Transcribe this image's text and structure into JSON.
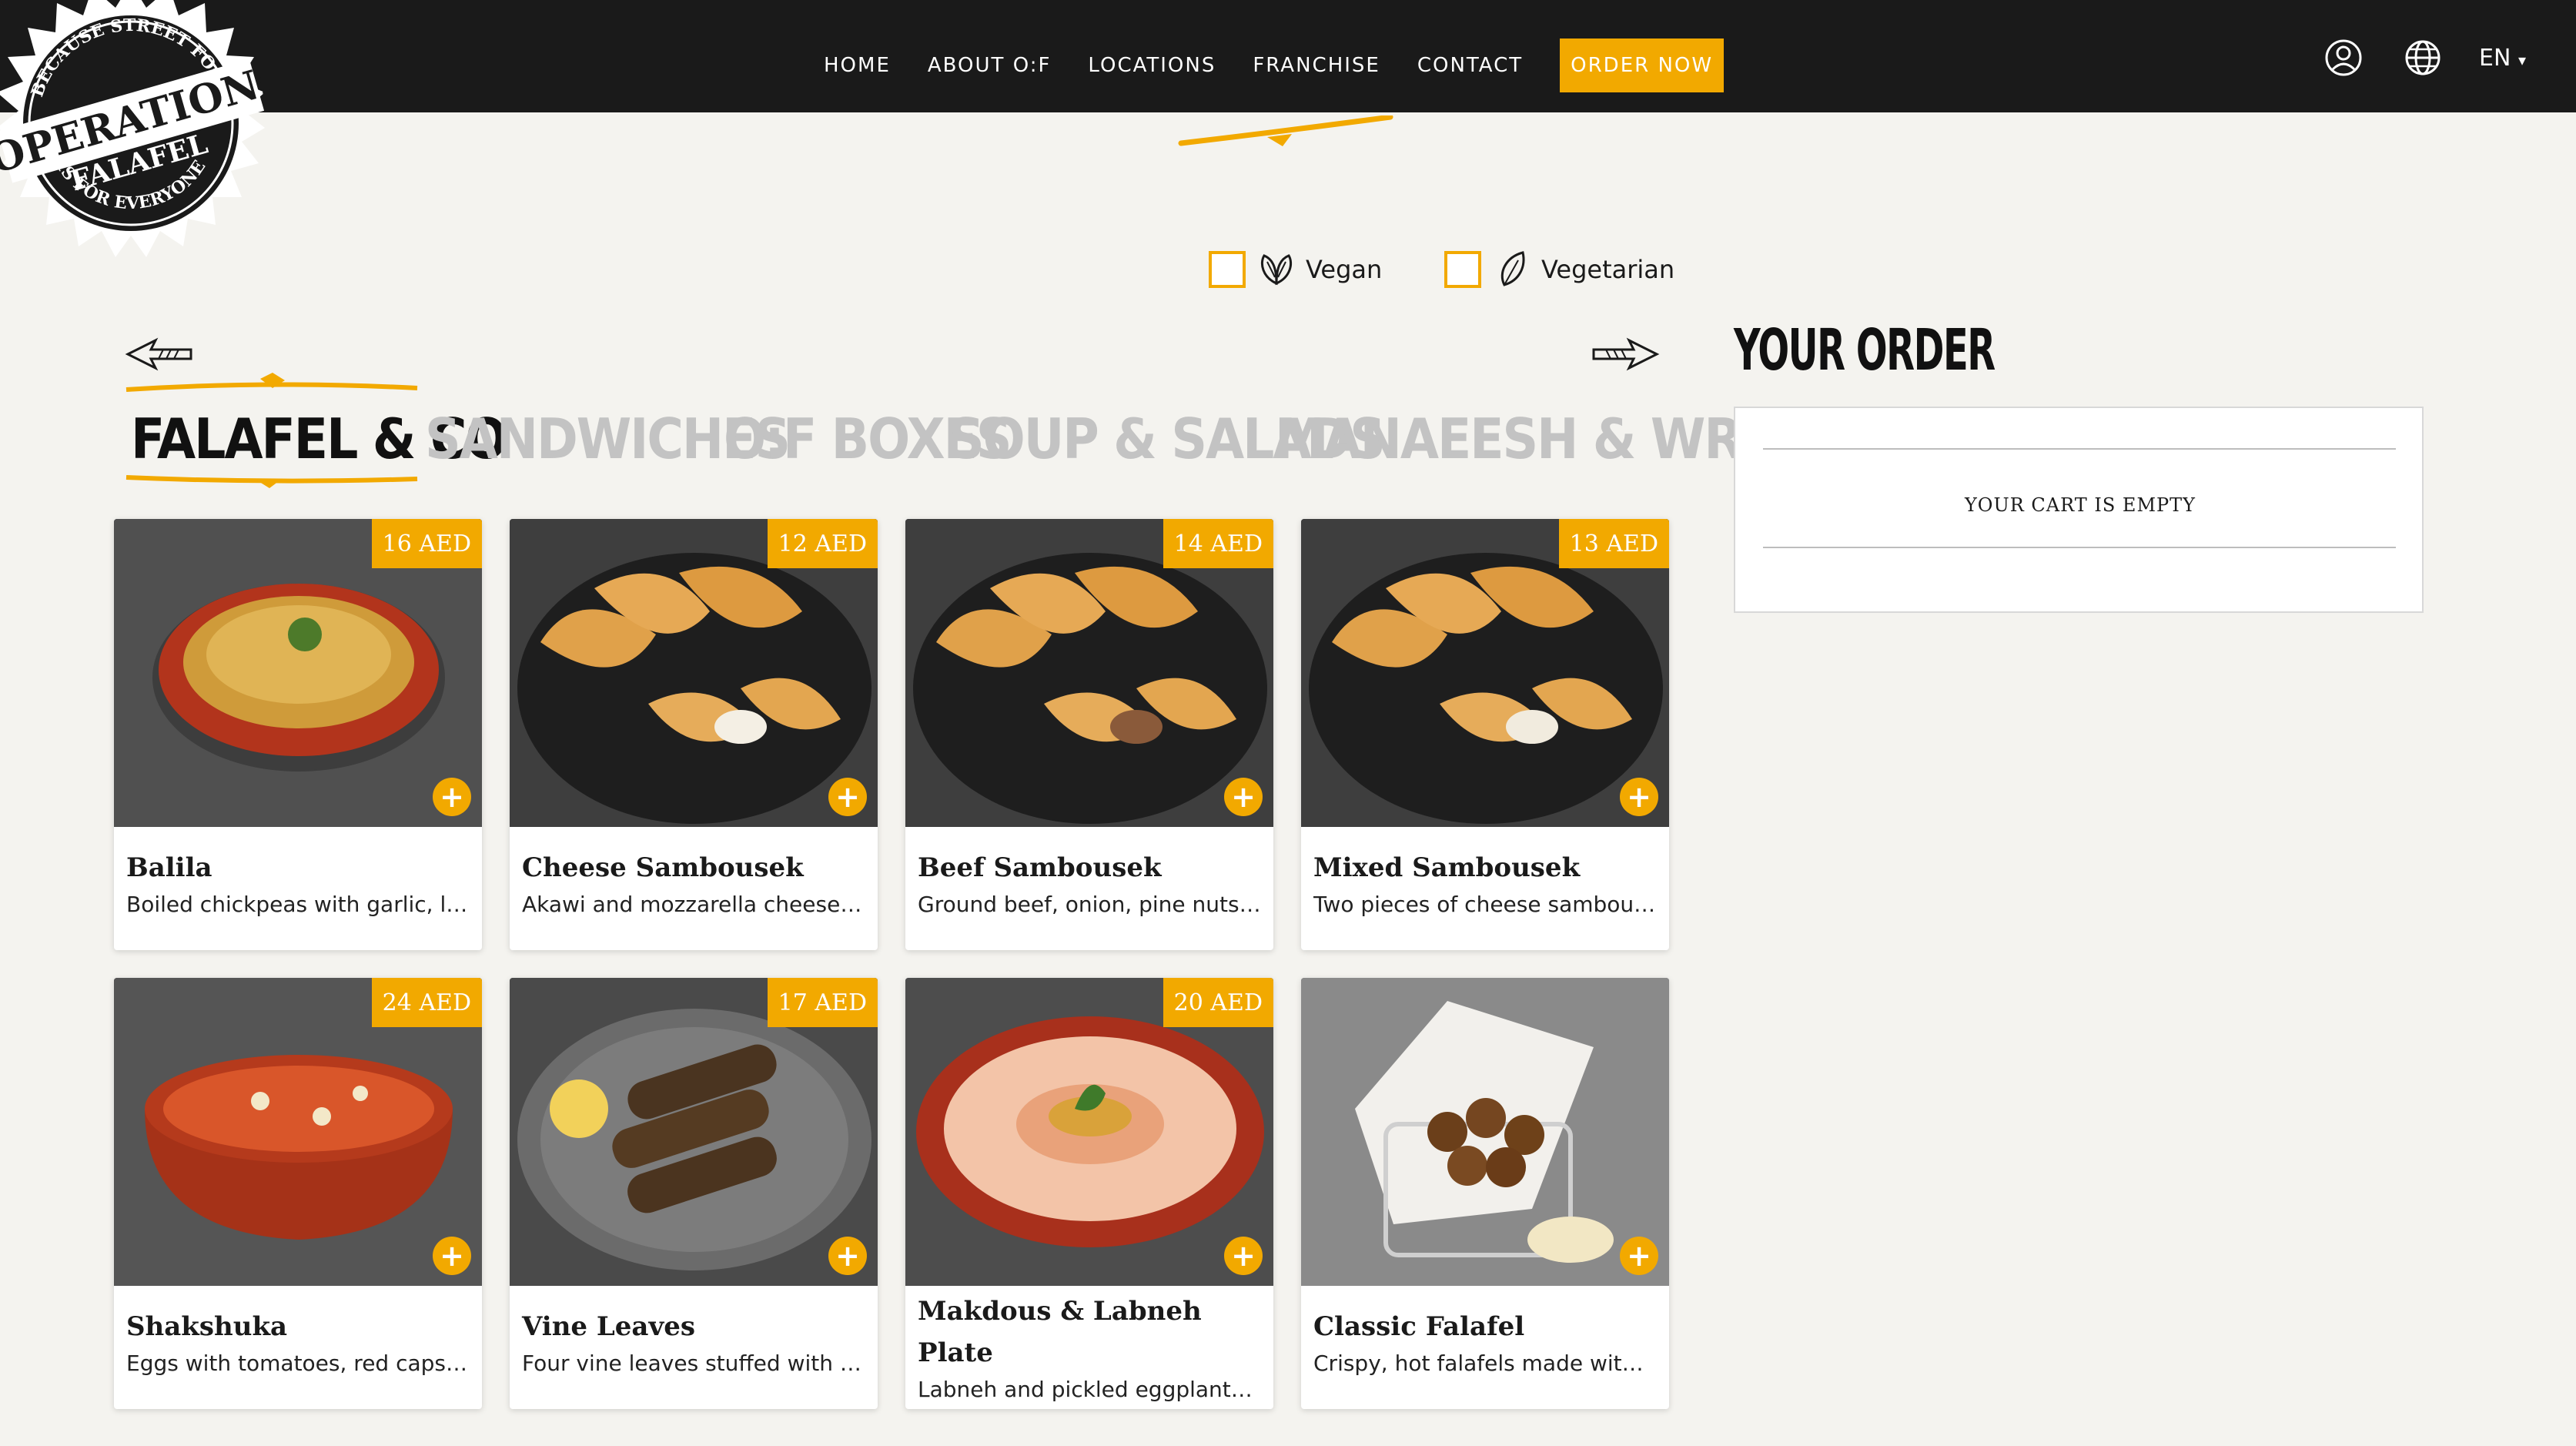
{
  "brand": {
    "seal_top": "BECAUSE STREET FOOD",
    "seal_main": "OPERATION:",
    "seal_sub": "FALAFEL",
    "seal_bottom": "IS FOR EVERYONE"
  },
  "nav": {
    "items": [
      "HOME",
      "ABOUT O:F",
      "LOCATIONS",
      "FRANCHISE",
      "CONTACT"
    ],
    "order_now": "ORDER NOW",
    "language": "EN"
  },
  "filters": {
    "vegan": {
      "label": "Vegan",
      "checked": false
    },
    "vegetarian": {
      "label": "Vegetarian",
      "checked": false
    }
  },
  "categories": [
    "FALAFEL & CO",
    "SANDWICHES",
    "O:F BOXES",
    "SOUP & SALADS",
    "MANAEESH & WRAPS"
  ],
  "active_category": "FALAFEL & CO",
  "menu_items": [
    {
      "name": "Balila",
      "price": "16 AED",
      "description": "Boiled chickpeas with garlic, lem...",
      "image": "balila"
    },
    {
      "name": "Cheese Sambousek",
      "price": "12 AED",
      "description": "Akawi and mozzarella cheese wi...",
      "image": "sambousek"
    },
    {
      "name": "Beef Sambousek",
      "price": "14 AED",
      "description": "Ground beef, onion, pine nuts, po...",
      "image": "sambousek"
    },
    {
      "name": "Mixed Sambousek",
      "price": "13 AED",
      "description": "Two pieces of cheese sambouse...",
      "image": "sambousek"
    },
    {
      "name": "Shakshuka",
      "price": "24 AED",
      "description": "Eggs with tomatoes, red capsicu...",
      "image": "shakshuka"
    },
    {
      "name": "Vine Leaves",
      "price": "17 AED",
      "description": "Four vine leaves stuffed with rice...",
      "image": "vine"
    },
    {
      "name": "Makdous & Labneh Plate",
      "price": "20 AED",
      "description": "Labneh and pickled eggplants st...",
      "image": "labneh"
    },
    {
      "name": "Classic Falafel",
      "price": "",
      "description": "Crispy, hot falafels made with ou...",
      "image": "falafel"
    }
  ],
  "order": {
    "title": "YOUR ORDER",
    "empty_text": "YOUR CART IS EMPTY"
  },
  "colors": {
    "accent": "#f2a900",
    "header": "#1a1a1a",
    "page_bg": "#f4f3ef"
  },
  "icons": [
    "user-icon",
    "globe-icon",
    "chevron-down-icon",
    "arrow-left-icon",
    "arrow-right-icon",
    "vegan-leaf-icon",
    "vegetarian-leaf-icon",
    "add-icon"
  ]
}
